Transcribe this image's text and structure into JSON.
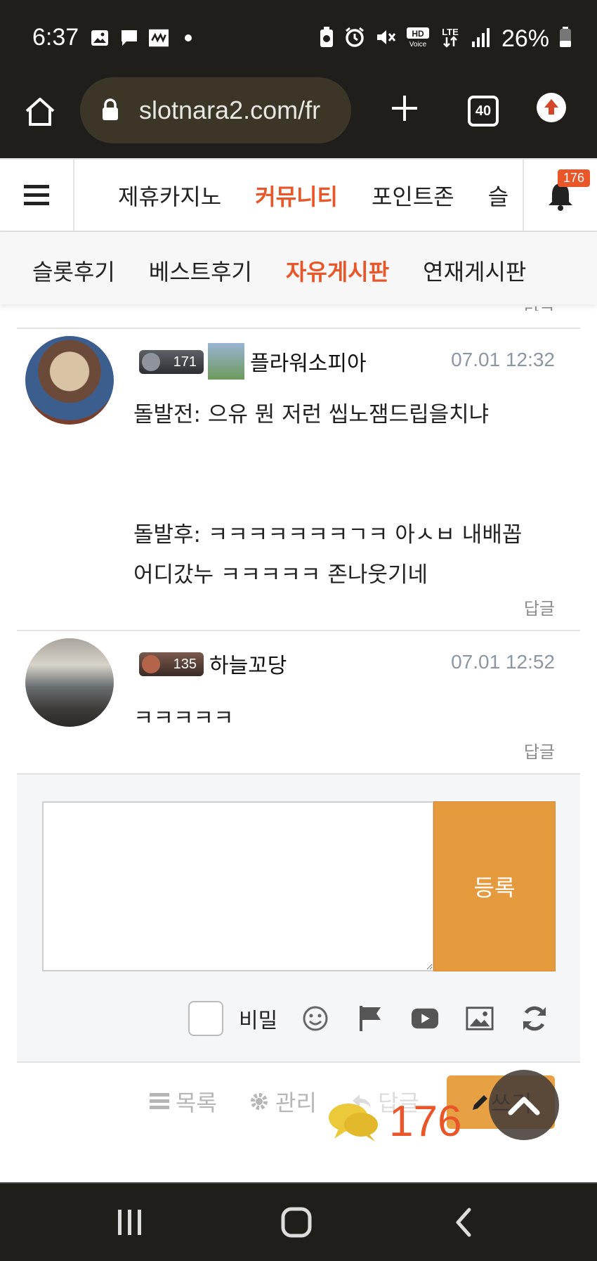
{
  "status_bar": {
    "time": "6:37",
    "icons_left": [
      "image-icon",
      "chat-bubble-icon",
      "app-icon",
      "dot-icon"
    ],
    "icons_right": [
      "recycle-icon",
      "alarm-icon",
      "mute-icon",
      "hd-voice-icon",
      "lte-icon",
      "signal-icon"
    ],
    "battery": "26%"
  },
  "browser": {
    "url": "slotnara2.com/fr",
    "tab_count": "40"
  },
  "site_nav": {
    "items": [
      {
        "label": "제휴카지노",
        "active": false
      },
      {
        "label": "커뮤니티",
        "active": true
      },
      {
        "label": "포인트존",
        "active": false
      },
      {
        "label": "슬",
        "active": false
      }
    ],
    "notification_count": "176"
  },
  "sub_nav": {
    "items": [
      {
        "label": "슬롯후기"
      },
      {
        "label": "베스트후기"
      },
      {
        "label": "자유게시판"
      },
      {
        "label": "연재게시판"
      }
    ]
  },
  "prev_reply_label": "답글",
  "comments": [
    {
      "level": "171",
      "author": "플라워소피아",
      "date": "07.01 12:32",
      "lines": [
        "돌발전: 으유 뭔 저런 씹노잼드립을치냐",
        "",
        "",
        "돌발후: ㅋㅋㅋㅋㅋㅋㅋㄱㅋ 아ㅅㅂ 내배꼽",
        "어디갔누 ㅋㅋㅋㅋㅋ 존나웃기네"
      ],
      "reply_label": "답글"
    },
    {
      "level": "135",
      "author": "하늘꼬당",
      "date": "07.01 12:52",
      "lines": [
        "ㅋㅋㅋㅋㅋ"
      ],
      "reply_label": "답글"
    }
  ],
  "form": {
    "submit_label": "등록",
    "secret_label": "비밀",
    "tools": [
      "smile-icon",
      "flag-icon",
      "youtube-icon",
      "image-icon",
      "refresh-icon"
    ]
  },
  "actions": {
    "list_label": "목록",
    "manage_label": "관리",
    "reply_label": "답글",
    "write_label": "쓰기"
  },
  "chat_float": {
    "count": "176"
  },
  "colors": {
    "accent": "#e8562a",
    "submit": "#e59a3d",
    "status_bg": "#201e1a"
  }
}
